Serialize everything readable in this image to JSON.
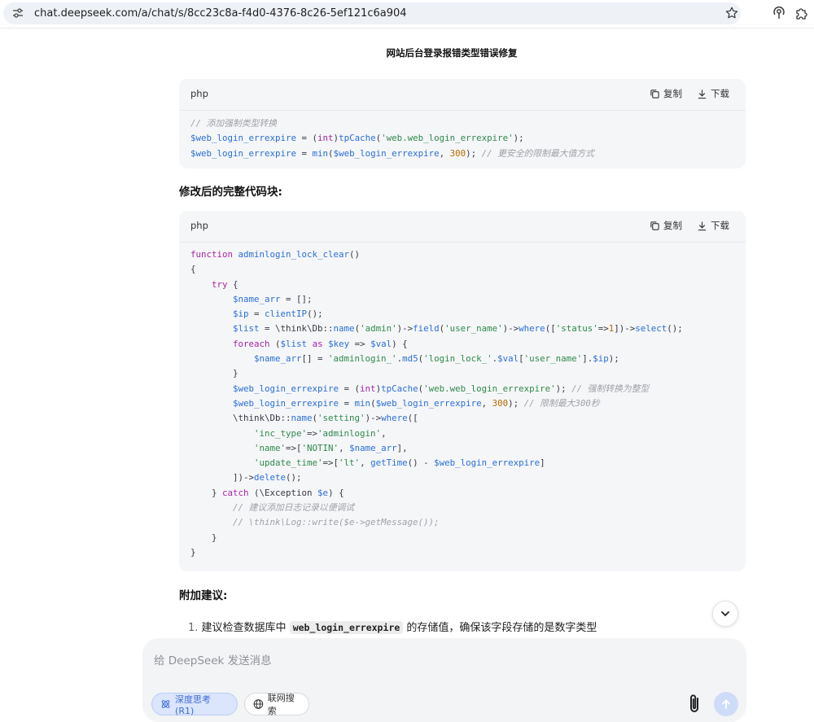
{
  "browser": {
    "url": "chat.deepseek.com/a/chat/s/8cc23c8a-f4d0-4376-8c26-5ef121c6a904"
  },
  "chat": {
    "title": "网站后台登录报错类型错误修复"
  },
  "code_tools": {
    "copy_label": "复制",
    "download_label": "下载"
  },
  "block1": {
    "lang": "php",
    "lines": [
      [
        [
          "c-cm",
          "// 添加强制类型转换"
        ]
      ],
      [
        [
          "c-var",
          "$web_login_errexpire"
        ],
        [
          "c-pl",
          " = ("
        ],
        [
          "c-kw",
          "int"
        ],
        [
          "c-pl",
          ")"
        ],
        [
          "c-fn",
          "tpCache"
        ],
        [
          "c-pl",
          "("
        ],
        [
          "c-str",
          "'web.web_login_errexpire'"
        ],
        [
          "c-pl",
          ");"
        ]
      ],
      [
        [
          "c-var",
          "$web_login_errexpire"
        ],
        [
          "c-pl",
          " = "
        ],
        [
          "c-fn",
          "min"
        ],
        [
          "c-pl",
          "("
        ],
        [
          "c-var",
          "$web_login_errexpire"
        ],
        [
          "c-pl",
          ", "
        ],
        [
          "c-num",
          "300"
        ],
        [
          "c-pl",
          "); "
        ],
        [
          "c-cm",
          "// 更安全的限制最大值方式"
        ]
      ]
    ]
  },
  "heading1": "修改后的完整代码块:",
  "block2": {
    "lang": "php",
    "lines": [
      [
        [
          "c-kw",
          "function "
        ],
        [
          "c-fn",
          "adminlogin_lock_clear"
        ],
        [
          "c-pl",
          "()"
        ]
      ],
      [
        [
          "c-pl",
          "{"
        ]
      ],
      [
        [
          "c-pl",
          "    "
        ],
        [
          "c-kw",
          "try"
        ],
        [
          "c-pl",
          " {"
        ]
      ],
      [
        [
          "c-pl",
          "        "
        ],
        [
          "c-var",
          "$name_arr"
        ],
        [
          "c-pl",
          " = [];"
        ]
      ],
      [
        [
          "c-pl",
          "        "
        ],
        [
          "c-var",
          "$ip"
        ],
        [
          "c-pl",
          " = "
        ],
        [
          "c-fn",
          "clientIP"
        ],
        [
          "c-pl",
          "();"
        ]
      ],
      [
        [
          "c-pl",
          "        "
        ],
        [
          "c-var",
          "$list"
        ],
        [
          "c-pl",
          " = \\think\\Db::"
        ],
        [
          "c-fn",
          "name"
        ],
        [
          "c-pl",
          "("
        ],
        [
          "c-str",
          "'admin'"
        ],
        [
          "c-pl",
          ")->"
        ],
        [
          "c-fn",
          "field"
        ],
        [
          "c-pl",
          "("
        ],
        [
          "c-str",
          "'user_name'"
        ],
        [
          "c-pl",
          ")->"
        ],
        [
          "c-fn",
          "where"
        ],
        [
          "c-pl",
          "(["
        ],
        [
          "c-str",
          "'status'"
        ],
        [
          "c-pl",
          "=>"
        ],
        [
          "c-num",
          "1"
        ],
        [
          "c-pl",
          "])->"
        ],
        [
          "c-fn",
          "select"
        ],
        [
          "c-pl",
          "();"
        ]
      ],
      [
        [
          "c-pl",
          "        "
        ],
        [
          "c-kw",
          "foreach"
        ],
        [
          "c-pl",
          " ("
        ],
        [
          "c-var",
          "$list"
        ],
        [
          "c-pl",
          " "
        ],
        [
          "c-kw",
          "as"
        ],
        [
          "c-pl",
          " "
        ],
        [
          "c-var",
          "$key"
        ],
        [
          "c-pl",
          " => "
        ],
        [
          "c-var",
          "$val"
        ],
        [
          "c-pl",
          ") {"
        ]
      ],
      [
        [
          "c-pl",
          "            "
        ],
        [
          "c-var",
          "$name_arr"
        ],
        [
          "c-pl",
          "[] = "
        ],
        [
          "c-str",
          "'adminlogin_'"
        ],
        [
          "c-pl",
          "."
        ],
        [
          "c-fn",
          "md5"
        ],
        [
          "c-pl",
          "("
        ],
        [
          "c-str",
          "'login_lock_'"
        ],
        [
          "c-pl",
          "."
        ],
        [
          "c-var",
          "$val"
        ],
        [
          "c-pl",
          "["
        ],
        [
          "c-str",
          "'user_name'"
        ],
        [
          "c-pl",
          "]."
        ],
        [
          "c-var",
          "$ip"
        ],
        [
          "c-pl",
          ");"
        ]
      ],
      [
        [
          "c-pl",
          "        }"
        ]
      ],
      [
        [
          "c-pl",
          "        "
        ],
        [
          "c-var",
          "$web_login_errexpire"
        ],
        [
          "c-pl",
          " = ("
        ],
        [
          "c-kw",
          "int"
        ],
        [
          "c-pl",
          ")"
        ],
        [
          "c-fn",
          "tpCache"
        ],
        [
          "c-pl",
          "("
        ],
        [
          "c-str",
          "'web.web_login_errexpire'"
        ],
        [
          "c-pl",
          "); "
        ],
        [
          "c-cm",
          "// 强制转换为整型"
        ]
      ],
      [
        [
          "c-pl",
          "        "
        ],
        [
          "c-var",
          "$web_login_errexpire"
        ],
        [
          "c-pl",
          " = "
        ],
        [
          "c-fn",
          "min"
        ],
        [
          "c-pl",
          "("
        ],
        [
          "c-var",
          "$web_login_errexpire"
        ],
        [
          "c-pl",
          ", "
        ],
        [
          "c-num",
          "300"
        ],
        [
          "c-pl",
          "); "
        ],
        [
          "c-cm",
          "// 限制最大300秒"
        ]
      ],
      [
        [
          "c-pl",
          "        \\think\\Db::"
        ],
        [
          "c-fn",
          "name"
        ],
        [
          "c-pl",
          "("
        ],
        [
          "c-str",
          "'setting'"
        ],
        [
          "c-pl",
          ")->"
        ],
        [
          "c-fn",
          "where"
        ],
        [
          "c-pl",
          "(["
        ]
      ],
      [
        [
          "c-pl",
          "            "
        ],
        [
          "c-str",
          "'inc_type'"
        ],
        [
          "c-pl",
          "=>"
        ],
        [
          "c-str",
          "'adminlogin'"
        ],
        [
          "c-pl",
          ","
        ]
      ],
      [
        [
          "c-pl",
          "            "
        ],
        [
          "c-str",
          "'name'"
        ],
        [
          "c-pl",
          "=>["
        ],
        [
          "c-str",
          "'NOTIN'"
        ],
        [
          "c-pl",
          ", "
        ],
        [
          "c-var",
          "$name_arr"
        ],
        [
          "c-pl",
          "],"
        ]
      ],
      [
        [
          "c-pl",
          "            "
        ],
        [
          "c-str",
          "'update_time'"
        ],
        [
          "c-pl",
          "=>["
        ],
        [
          "c-str",
          "'lt'"
        ],
        [
          "c-pl",
          ", "
        ],
        [
          "c-fn",
          "getTime"
        ],
        [
          "c-pl",
          "() - "
        ],
        [
          "c-var",
          "$web_login_errexpire"
        ],
        [
          "c-pl",
          "]"
        ]
      ],
      [
        [
          "c-pl",
          "        ])->"
        ],
        [
          "c-fn",
          "delete"
        ],
        [
          "c-pl",
          "();"
        ]
      ],
      [
        [
          "c-pl",
          "    } "
        ],
        [
          "c-kw",
          "catch"
        ],
        [
          "c-pl",
          " (\\Exception "
        ],
        [
          "c-var",
          "$e"
        ],
        [
          "c-pl",
          ") {"
        ]
      ],
      [
        [
          "c-pl",
          "        "
        ],
        [
          "c-cm",
          "// 建议添加日志记录以便调试"
        ]
      ],
      [
        [
          "c-pl",
          "        "
        ],
        [
          "c-cm",
          "// \\think\\Log::write($e->getMessage());"
        ]
      ],
      [
        [
          "c-pl",
          "    }"
        ]
      ],
      [
        [
          "c-pl",
          "}"
        ]
      ]
    ]
  },
  "heading2": "附加建议:",
  "suggestion": {
    "number": "1.",
    "text_before": "建议检查数据库中",
    "code": "web_login_errexpire",
    "text_after": "的存储值，确保该字段存储的是数字类型"
  },
  "composer": {
    "placeholder": "给 DeepSeek 发送消息",
    "deep_think_label": "深度思考 (R1)",
    "web_search_label": "联网搜索"
  },
  "colors": {
    "accent": "#4d6bfe",
    "chip_active_bg": "#dbe5fb",
    "send_disabled": "#cfdcf8"
  },
  "icons": [
    "site-settings-icon",
    "star-icon",
    "extension-icon",
    "extension-puzzle-icon",
    "copy-icon",
    "download-icon",
    "chevron-down-icon",
    "atom-icon",
    "globe-icon",
    "paperclip-icon",
    "arrow-up-icon"
  ]
}
